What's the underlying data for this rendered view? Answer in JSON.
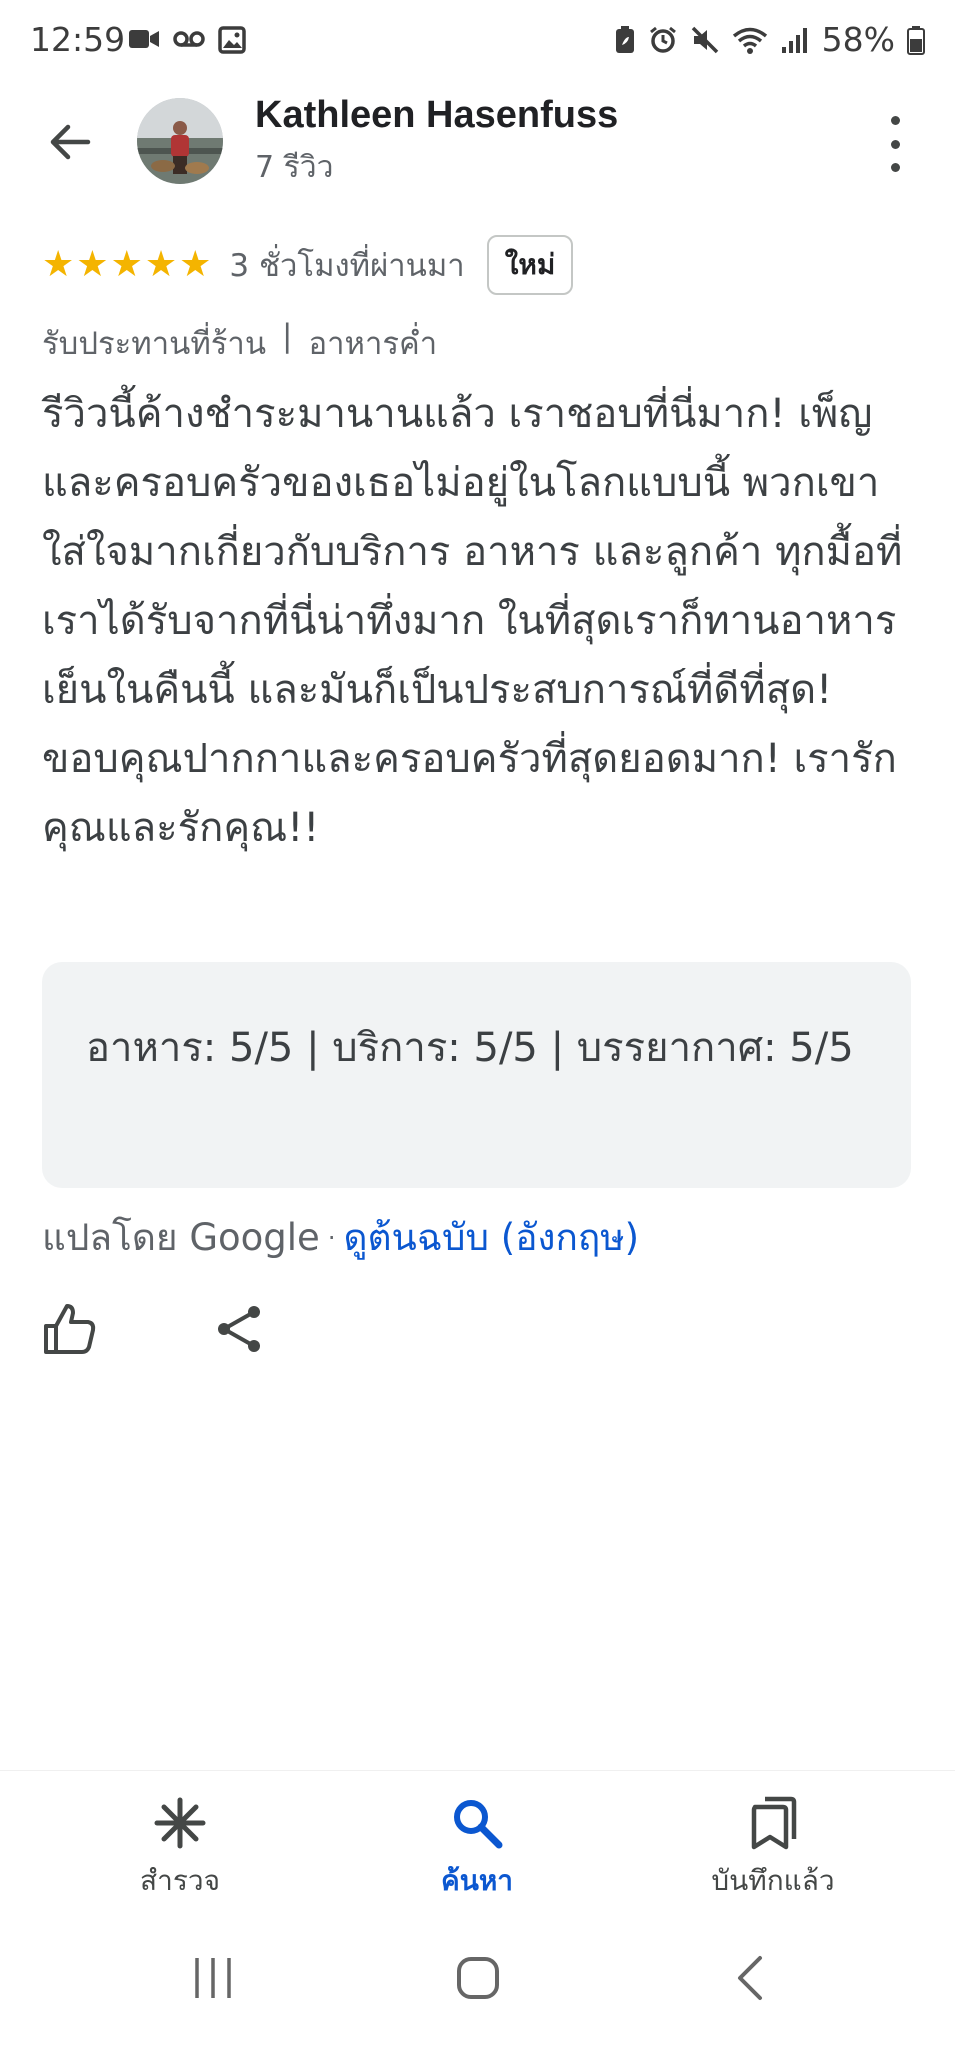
{
  "status_bar": {
    "time": "12:59",
    "battery_percent": "58%",
    "left_icons": [
      "video-icon",
      "voicemail-icon",
      "image-icon"
    ],
    "right_icons": [
      "battery-saver-icon",
      "alarm-icon",
      "mute-icon",
      "wifi-icon",
      "signal-icon",
      "battery-icon"
    ]
  },
  "header": {
    "reviewer_name": "Kathleen Hasenfuss",
    "review_count": "7 รีวิว"
  },
  "review": {
    "rating": 5,
    "stars": [
      "★",
      "★",
      "★",
      "★",
      "★"
    ],
    "time_ago": "3 ชั่วโมงที่ผ่านมา",
    "badge": "ใหม่",
    "service_type": "รับประทานที่ร้าน",
    "separator": "|",
    "meal_type": "อาหารค่ำ",
    "text": "รีวิวนี้ค้างชำระมานานแล้ว เราชอบที่นี่มาก! เพ็ญและครอบครัวของเธอไม่อยู่ในโลกแบบนี้ พวกเขาใส่ใจมากเกี่ยวกับบริการ อาหาร และลูกค้า ทุกมื้อที่เราได้รับจากที่นี่น่าทึ่งมาก ในที่สุดเราก็ทานอาหารเย็นในคืนนี้ และมันก็เป็นประสบการณ์ที่ดีที่สุด! ขอบคุณปากกาและครอบครัวที่สุดยอดมาก! เรารักคุณและรักคุณ!!",
    "sub_ratings": "อาหาร: 5/5  |  บริการ: 5/5  |  บรรยากาศ: 5/5",
    "translated_by": "แปลโดย Google",
    "dot": "·",
    "view_original": "ดูต้นฉบับ (อังกฤษ)"
  },
  "bottom_nav": {
    "items": [
      {
        "label": "สำรวจ",
        "icon": "explore-icon",
        "active": false
      },
      {
        "label": "ค้นหา",
        "icon": "search-icon",
        "active": true
      },
      {
        "label": "บันทึกแล้ว",
        "icon": "saved-icon",
        "active": false
      }
    ]
  },
  "colors": {
    "star": "#f4b400",
    "accent": "#0b57d0",
    "box_bg": "#f1f3f4",
    "secondary_text": "#5f6368"
  }
}
